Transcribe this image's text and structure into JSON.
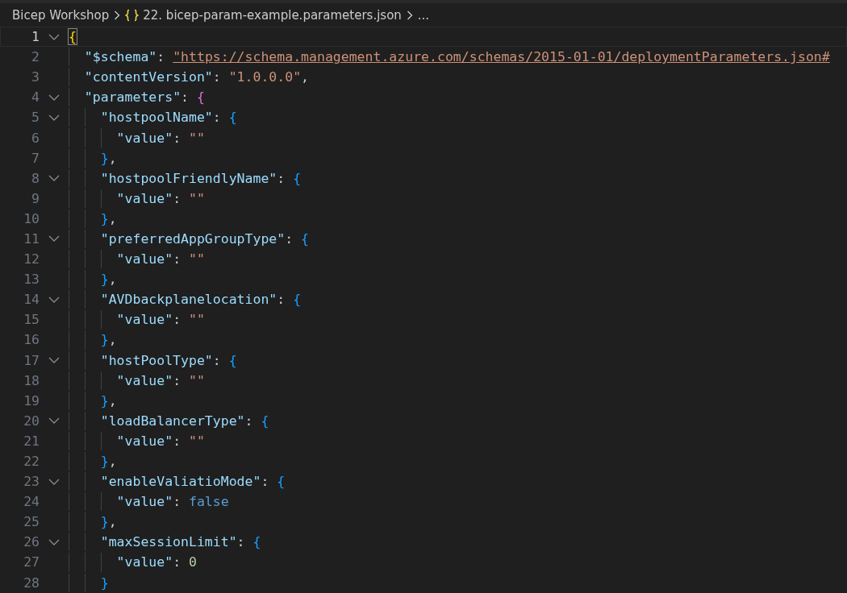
{
  "breadcrumb": [
    {
      "kind": "folder",
      "label": "Bicep Workshop"
    },
    {
      "kind": "json-file",
      "label": "22. bicep-param-example.parameters.json"
    },
    {
      "kind": "more",
      "label": "..."
    }
  ],
  "lines": [
    {
      "number": "1",
      "current": true,
      "expanded": true,
      "tokens": [
        {
          "kind": "bracket",
          "text": "{",
          "color": "#ffd700"
        }
      ],
      "children": [
        {
          "number": "2",
          "current": false,
          "tokens": [
            {
              "kind": "key",
              "text": "\"$schema\""
            },
            {
              "kind": "punct",
              "text": ": "
            },
            {
              "kind": "link",
              "text": "\"https://schema.management.azure.com/schemas/2015-01-01/deploymentParameters.json#"
            }
          ]
        },
        {
          "number": "3",
          "current": false,
          "tokens": [
            {
              "kind": "key",
              "text": "\"contentVersion\""
            },
            {
              "kind": "punct",
              "text": ": "
            },
            {
              "kind": "string",
              "text": "\"1.0.0.0\""
            },
            {
              "kind": "punct",
              "text": ","
            }
          ]
        },
        {
          "number": "4",
          "current": false,
          "expanded": true,
          "tokens": [
            {
              "kind": "key",
              "text": "\"parameters\""
            },
            {
              "kind": "punct",
              "text": ": "
            },
            {
              "kind": "bracket",
              "text": "{",
              "color": "#da70d6"
            }
          ],
          "children": [
            {
              "number": "5",
              "current": false,
              "expanded": true,
              "tokens": [
                {
                  "kind": "key",
                  "text": "\"hostpoolName\""
                },
                {
                  "kind": "punct",
                  "text": ": "
                },
                {
                  "kind": "bracket",
                  "text": "{",
                  "color": "#179fff"
                }
              ],
              "children": [
                {
                  "number": "6",
                  "current": false,
                  "tokens": [
                    {
                      "kind": "key",
                      "text": "\"value\""
                    },
                    {
                      "kind": "punct",
                      "text": ": "
                    },
                    {
                      "kind": "string",
                      "text": "\"\""
                    }
                  ]
                }
              ]
            },
            {
              "number": "7",
              "current": false,
              "tokens": [
                {
                  "kind": "bracket",
                  "text": "}",
                  "color": "#179fff"
                },
                {
                  "kind": "punct",
                  "text": ","
                }
              ]
            },
            {
              "number": "8",
              "current": false,
              "expanded": true,
              "tokens": [
                {
                  "kind": "key",
                  "text": "\"hostpoolFriendlyName\""
                },
                {
                  "kind": "punct",
                  "text": ": "
                },
                {
                  "kind": "bracket",
                  "text": "{",
                  "color": "#179fff"
                }
              ],
              "children": [
                {
                  "number": "9",
                  "current": false,
                  "tokens": [
                    {
                      "kind": "key",
                      "text": "\"value\""
                    },
                    {
                      "kind": "punct",
                      "text": ": "
                    },
                    {
                      "kind": "string",
                      "text": "\"\""
                    }
                  ]
                }
              ]
            },
            {
              "number": "10",
              "current": false,
              "tokens": [
                {
                  "kind": "bracket",
                  "text": "}",
                  "color": "#179fff"
                },
                {
                  "kind": "punct",
                  "text": ","
                }
              ]
            },
            {
              "number": "11",
              "current": false,
              "expanded": true,
              "tokens": [
                {
                  "kind": "key",
                  "text": "\"preferredAppGroupType\""
                },
                {
                  "kind": "punct",
                  "text": ": "
                },
                {
                  "kind": "bracket",
                  "text": "{",
                  "color": "#179fff"
                }
              ],
              "children": [
                {
                  "number": "12",
                  "current": false,
                  "tokens": [
                    {
                      "kind": "key",
                      "text": "\"value\""
                    },
                    {
                      "kind": "punct",
                      "text": ": "
                    },
                    {
                      "kind": "string",
                      "text": "\"\""
                    }
                  ]
                }
              ]
            },
            {
              "number": "13",
              "current": false,
              "tokens": [
                {
                  "kind": "bracket",
                  "text": "}",
                  "color": "#179fff"
                },
                {
                  "kind": "punct",
                  "text": ","
                }
              ]
            },
            {
              "number": "14",
              "current": false,
              "expanded": true,
              "tokens": [
                {
                  "kind": "key",
                  "text": "\"AVDbackplanelocation\""
                },
                {
                  "kind": "punct",
                  "text": ": "
                },
                {
                  "kind": "bracket",
                  "text": "{",
                  "color": "#179fff"
                }
              ],
              "children": [
                {
                  "number": "15",
                  "current": false,
                  "tokens": [
                    {
                      "kind": "key",
                      "text": "\"value\""
                    },
                    {
                      "kind": "punct",
                      "text": ": "
                    },
                    {
                      "kind": "string",
                      "text": "\"\""
                    }
                  ]
                }
              ]
            },
            {
              "number": "16",
              "current": false,
              "tokens": [
                {
                  "kind": "bracket",
                  "text": "}",
                  "color": "#179fff"
                },
                {
                  "kind": "punct",
                  "text": ","
                }
              ]
            },
            {
              "number": "17",
              "current": false,
              "expanded": true,
              "tokens": [
                {
                  "kind": "key",
                  "text": "\"hostPoolType\""
                },
                {
                  "kind": "punct",
                  "text": ": "
                },
                {
                  "kind": "bracket",
                  "text": "{",
                  "color": "#179fff"
                }
              ],
              "children": [
                {
                  "number": "18",
                  "current": false,
                  "tokens": [
                    {
                      "kind": "key",
                      "text": "\"value\""
                    },
                    {
                      "kind": "punct",
                      "text": ": "
                    },
                    {
                      "kind": "string",
                      "text": "\"\""
                    }
                  ]
                }
              ]
            },
            {
              "number": "19",
              "current": false,
              "tokens": [
                {
                  "kind": "bracket",
                  "text": "}",
                  "color": "#179fff"
                },
                {
                  "kind": "punct",
                  "text": ","
                }
              ]
            },
            {
              "number": "20",
              "current": false,
              "expanded": true,
              "tokens": [
                {
                  "kind": "key",
                  "text": "\"loadBalancerType\""
                },
                {
                  "kind": "punct",
                  "text": ": "
                },
                {
                  "kind": "bracket",
                  "text": "{",
                  "color": "#179fff"
                }
              ],
              "children": [
                {
                  "number": "21",
                  "current": false,
                  "tokens": [
                    {
                      "kind": "key",
                      "text": "\"value\""
                    },
                    {
                      "kind": "punct",
                      "text": ": "
                    },
                    {
                      "kind": "string",
                      "text": "\"\""
                    }
                  ]
                }
              ]
            },
            {
              "number": "22",
              "current": false,
              "tokens": [
                {
                  "kind": "bracket",
                  "text": "}",
                  "color": "#179fff"
                },
                {
                  "kind": "punct",
                  "text": ","
                }
              ]
            },
            {
              "number": "23",
              "current": false,
              "expanded": true,
              "tokens": [
                {
                  "kind": "key",
                  "text": "\"enableValiatioMode\""
                },
                {
                  "kind": "punct",
                  "text": ": "
                },
                {
                  "kind": "bracket",
                  "text": "{",
                  "color": "#179fff"
                }
              ],
              "children": [
                {
                  "number": "24",
                  "current": false,
                  "tokens": [
                    {
                      "kind": "key",
                      "text": "\"value\""
                    },
                    {
                      "kind": "punct",
                      "text": ": "
                    },
                    {
                      "kind": "keyword",
                      "text": "false"
                    }
                  ]
                }
              ]
            },
            {
              "number": "25",
              "current": false,
              "tokens": [
                {
                  "kind": "bracket",
                  "text": "}",
                  "color": "#179fff"
                },
                {
                  "kind": "punct",
                  "text": ","
                }
              ]
            },
            {
              "number": "26",
              "current": false,
              "expanded": true,
              "tokens": [
                {
                  "kind": "key",
                  "text": "\"maxSessionLimit\""
                },
                {
                  "kind": "punct",
                  "text": ": "
                },
                {
                  "kind": "bracket",
                  "text": "{",
                  "color": "#179fff"
                }
              ],
              "children": [
                {
                  "number": "27",
                  "current": false,
                  "tokens": [
                    {
                      "kind": "key",
                      "text": "\"value\""
                    },
                    {
                      "kind": "punct",
                      "text": ": "
                    },
                    {
                      "kind": "number",
                      "text": "0"
                    }
                  ]
                }
              ]
            },
            {
              "number": "28",
              "current": false,
              "tokens": [
                {
                  "kind": "bracket",
                  "text": "}",
                  "color": "#179fff"
                }
              ]
            }
          ]
        }
      ]
    }
  ]
}
